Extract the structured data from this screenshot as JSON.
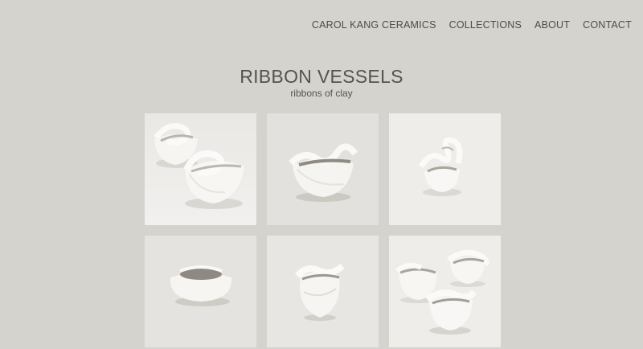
{
  "nav": {
    "brand": "CAROL KANG CERAMICS",
    "items": [
      "COLLECTIONS",
      "ABOUT",
      "CONTACT"
    ]
  },
  "page": {
    "title": "RIBBON VESSELS",
    "subtitle": "ribbons of clay"
  },
  "gallery": {
    "count": 6,
    "background": "#eeedea"
  },
  "colors": {
    "page_bg": "#d5d3ce",
    "text": "#4e4c48",
    "vessel": "#f7f6f3",
    "shadow": "#c9c6c0"
  }
}
